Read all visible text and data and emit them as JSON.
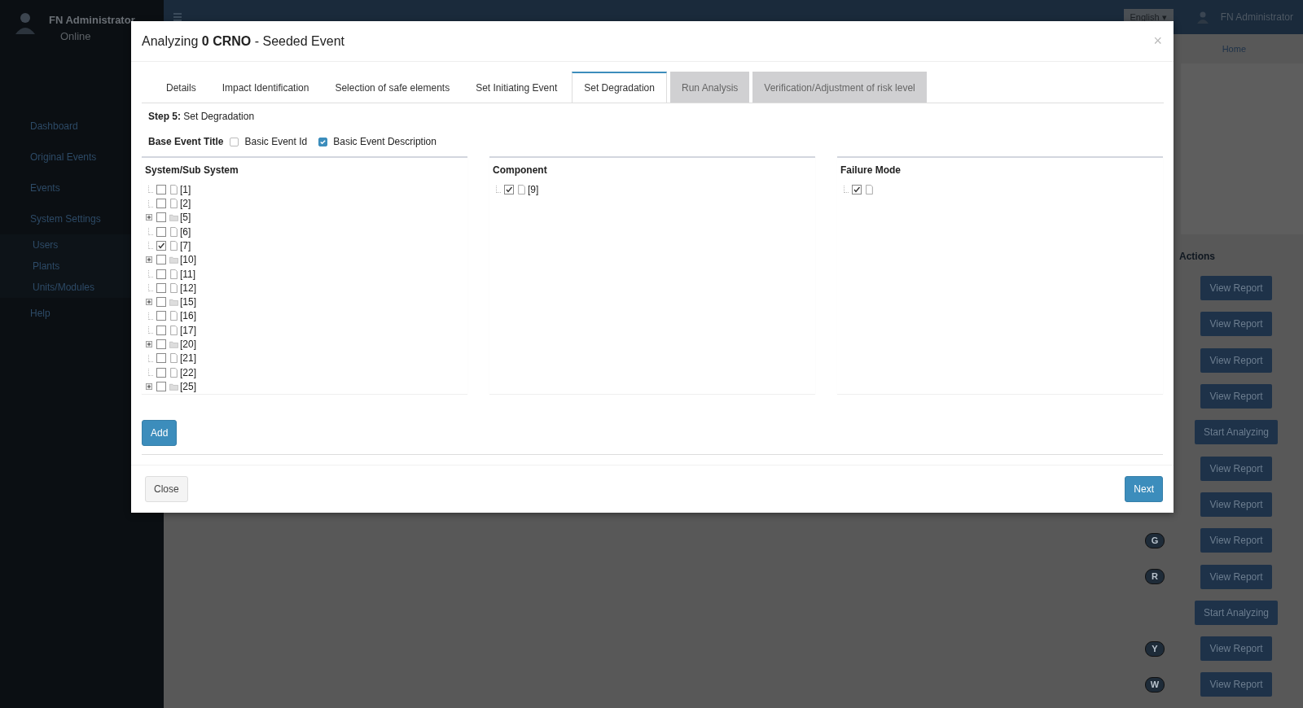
{
  "top_bar": {
    "language": "English ▾",
    "user": "FN Administrator"
  },
  "sidebar": {
    "user": "FN Administrator",
    "status": "Online",
    "items": [
      {
        "label": "Dashboard",
        "kind": "main"
      },
      {
        "label": "Original Events",
        "kind": "main"
      },
      {
        "label": "Events",
        "kind": "main"
      },
      {
        "label": "System Settings",
        "kind": "main"
      },
      {
        "label": "Users",
        "kind": "sub"
      },
      {
        "label": "Plants",
        "kind": "sub"
      },
      {
        "label": "Units/Modules",
        "kind": "sub"
      },
      {
        "label": "Help",
        "kind": "main"
      }
    ]
  },
  "breadcrumb": "Home",
  "table": {
    "actions_header": "Actions",
    "rows": [
      {
        "action": "View Report"
      },
      {
        "action": "View Report"
      },
      {
        "action": "View Report"
      },
      {
        "action": "View Report"
      },
      {
        "action": "Start Analyzing"
      },
      {
        "action": "View Report"
      },
      {
        "action": "View Report"
      },
      {
        "badge": "G",
        "action": "View Report"
      },
      {
        "badge": "R",
        "action": "View Report"
      },
      {
        "action": "Start Analyzing"
      },
      {
        "badge": "Y",
        "action": "View Report"
      },
      {
        "badge": "W",
        "action": "View Report"
      }
    ]
  },
  "modal": {
    "title": "Analyzing **0 CRNO** - Seeded Event",
    "close_icon": "×",
    "tabs": [
      {
        "label": "Details",
        "selected": false,
        "disabled": false
      },
      {
        "label": "Impact Identification",
        "selected": false,
        "disabled": false
      },
      {
        "label": "Selection of safe elements",
        "selected": false,
        "disabled": false
      },
      {
        "label": "Set Initiating Event",
        "selected": false,
        "disabled": false
      },
      {
        "label": "Set Degradation",
        "selected": true,
        "disabled": false
      },
      {
        "label": "Run Analysis",
        "selected": false,
        "disabled": true
      },
      {
        "label": "Verification/Adjustment of risk level",
        "selected": false,
        "disabled": true
      }
    ],
    "step": "**Step 5:** Set Degradation",
    "title_options": {
      "label": "Base Event Title",
      "options": [
        {
          "label": "Basic Event Id",
          "checked": false
        },
        {
          "label": "Basic Event Description",
          "checked": true
        }
      ]
    },
    "panels": [
      {
        "title": "System/Sub System",
        "items": [
          {
            "label": "[1]",
            "kind": "leaf",
            "checked": false
          },
          {
            "label": "[2]",
            "kind": "leaf",
            "checked": false
          },
          {
            "label": "[5]",
            "kind": "folder",
            "checked": false
          },
          {
            "label": "[6]",
            "kind": "leaf",
            "checked": false
          },
          {
            "label": "[7]",
            "kind": "leaf",
            "checked": true
          },
          {
            "label": "[10]",
            "kind": "folder",
            "checked": false
          },
          {
            "label": "[11]",
            "kind": "leaf",
            "checked": false
          },
          {
            "label": "[12]",
            "kind": "leaf",
            "checked": false
          },
          {
            "label": "[15]",
            "kind": "folder",
            "checked": false
          },
          {
            "label": "[16]",
            "kind": "leaf",
            "checked": false
          },
          {
            "label": "[17]",
            "kind": "leaf",
            "checked": false
          },
          {
            "label": "[20]",
            "kind": "folder",
            "checked": false
          },
          {
            "label": "[21]",
            "kind": "leaf",
            "checked": false
          },
          {
            "label": "[22]",
            "kind": "leaf",
            "checked": false
          },
          {
            "label": "[25]",
            "kind": "folder",
            "checked": false
          }
        ]
      },
      {
        "title": "Component",
        "items": [
          {
            "label": "[9]",
            "kind": "leaf",
            "checked": true
          }
        ]
      },
      {
        "title": "Failure Mode",
        "items": [
          {
            "kind": "leaf",
            "checked": true
          }
        ]
      }
    ],
    "add_button": "Add",
    "close_button": "Close",
    "next_button": "Next"
  }
}
